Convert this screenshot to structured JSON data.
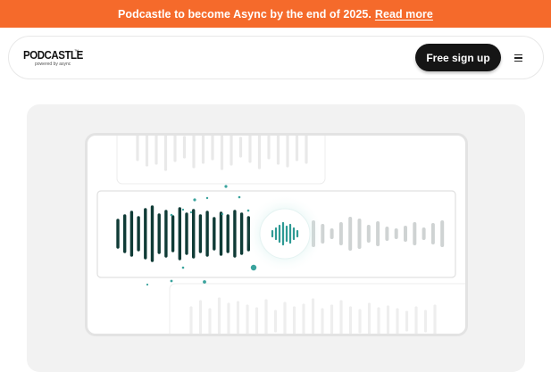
{
  "banner": {
    "text": "Podcastle to become Async by the end of 2025.",
    "link_label": "Read more"
  },
  "nav": {
    "logo_text": "PODCASTLE",
    "logo_tm": "™",
    "logo_tagline": "powered by async",
    "signup_label": "Free sign up",
    "menu_icon": "hamburger-menu-icon"
  },
  "hero": {
    "icons": [
      "audio-waveform-icon",
      "audio-enhance-icon"
    ]
  },
  "colors": {
    "banner_bg": "#f56a2b",
    "button_bg": "#151515",
    "wave_dark": "#0f3b36",
    "wave_light": "#cfd3d3",
    "accent_teal": "#3aa39d",
    "panel_bg": "#f2f2f2"
  }
}
